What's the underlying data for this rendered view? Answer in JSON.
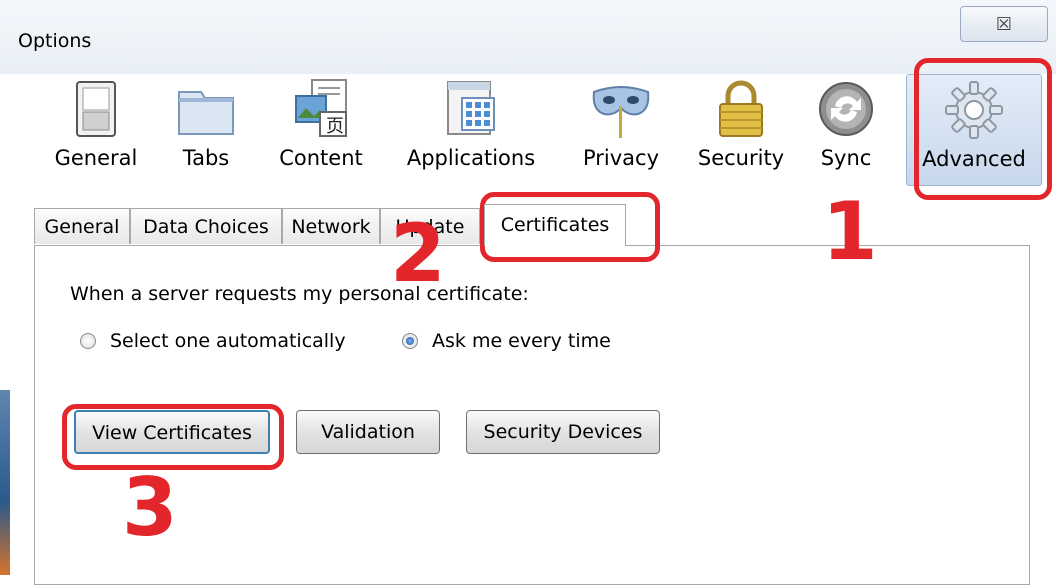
{
  "window": {
    "title": "Options",
    "close_glyph": "☒"
  },
  "toolbar": {
    "items": [
      {
        "label": "General",
        "icon": "switch-icon"
      },
      {
        "label": "Tabs",
        "icon": "folder-tabs-icon"
      },
      {
        "label": "Content",
        "icon": "content-image-icon"
      },
      {
        "label": "Applications",
        "icon": "applications-grid-icon"
      },
      {
        "label": "Privacy",
        "icon": "mask-icon"
      },
      {
        "label": "Security",
        "icon": "padlock-icon"
      },
      {
        "label": "Sync",
        "icon": "sync-icon"
      },
      {
        "label": "Advanced",
        "icon": "gear-icon",
        "selected": true
      }
    ]
  },
  "subtabs": {
    "items": [
      {
        "label": "General"
      },
      {
        "label": "Data Choices"
      },
      {
        "label": "Network"
      },
      {
        "label": "Update"
      },
      {
        "label": "Certificates",
        "active": true
      }
    ]
  },
  "certificates": {
    "prompt": "When a server requests my personal certificate:",
    "options": [
      {
        "label": "Select one automatically",
        "checked": false
      },
      {
        "label": "Ask me every time",
        "checked": true
      }
    ],
    "buttons": {
      "view_certificates": "View Certificates",
      "validation": "Validation",
      "security_devices": "Security Devices"
    }
  },
  "annotations": {
    "step1": "1",
    "step2": "2",
    "step3": "3",
    "color": "#e3262b"
  }
}
